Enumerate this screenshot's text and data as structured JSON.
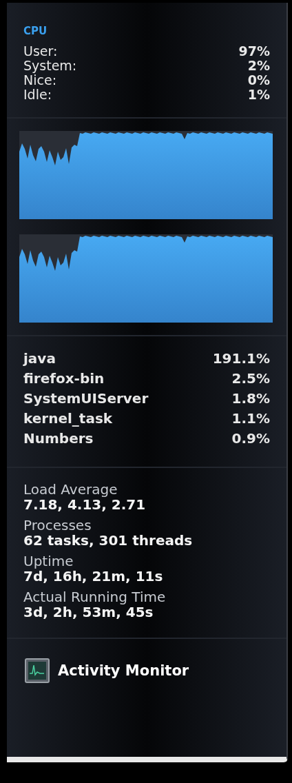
{
  "section_title": "CPU",
  "usage": [
    {
      "label": "User:",
      "value": "97%"
    },
    {
      "label": "System:",
      "value": "2%"
    },
    {
      "label": "Nice:",
      "value": "0%"
    },
    {
      "label": "Idle:",
      "value": "1%"
    }
  ],
  "processes": [
    {
      "name": "java",
      "value": "191.1%"
    },
    {
      "name": "firefox-bin",
      "value": "2.5%"
    },
    {
      "name": "SystemUIServer",
      "value": "1.8%"
    },
    {
      "name": "kernel_task",
      "value": "1.1%"
    },
    {
      "name": "Numbers",
      "value": "0.9%"
    }
  ],
  "info": [
    {
      "label": "Load Average",
      "value": "7.18, 4.13, 2.71"
    },
    {
      "label": "Processes",
      "value": "62 tasks, 301 threads"
    },
    {
      "label": "Uptime",
      "value": "7d, 16h, 21m, 11s"
    },
    {
      "label": "Actual Running Time",
      "value": "3d, 2h, 53m, 45s"
    }
  ],
  "footer": {
    "label": "Activity Monitor"
  }
}
